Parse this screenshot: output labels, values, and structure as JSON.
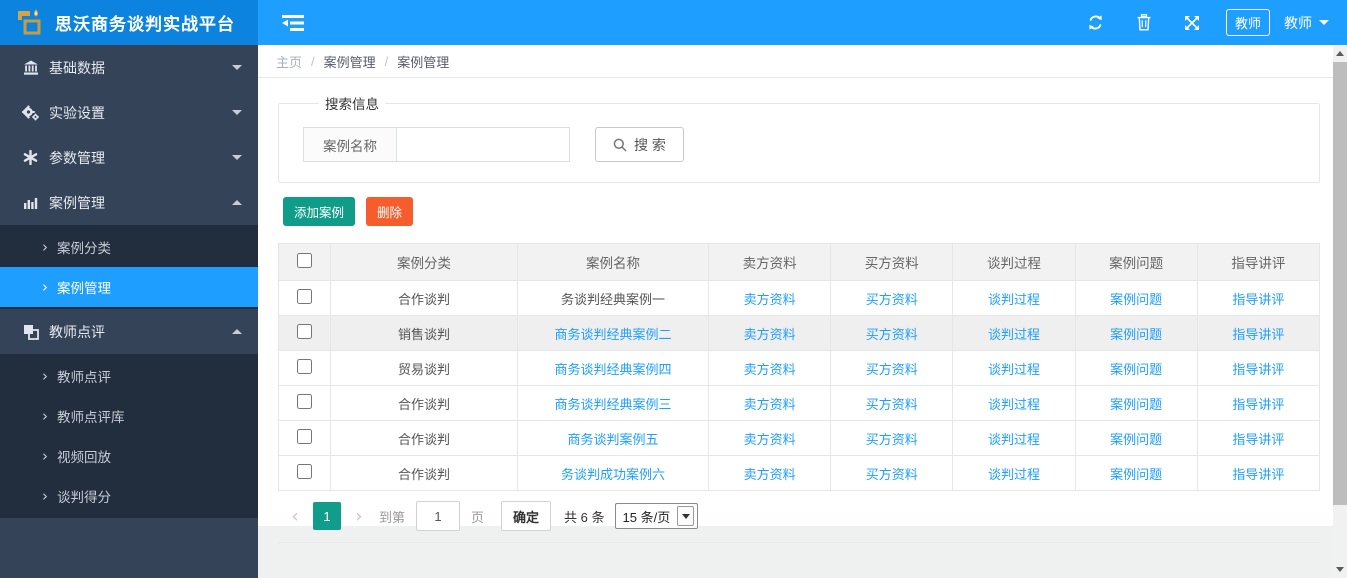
{
  "colors": {
    "header_left_bg": "#0C83DE",
    "header_right_bg": "#1E9FFF",
    "sidebar_bg": "#344358",
    "submenu_bg": "#222D3D",
    "accent_blue": "#1E9FFF",
    "teal_green": "#0F9D8A",
    "orange_red": "#F55D2C",
    "link_blue": "#1E9FFF"
  },
  "header": {
    "title": "思沃商务谈判实战平台",
    "role_badge": "教师",
    "user_name": "教师",
    "icons": [
      "menu-toggle-icon",
      "refresh-icon",
      "trash-icon",
      "expand-icon"
    ]
  },
  "sidebar": {
    "groups": [
      {
        "label": "基础数据",
        "icon": "bank-icon",
        "expanded": false
      },
      {
        "label": "实验设置",
        "icon": "gears-icon",
        "expanded": false
      },
      {
        "label": "参数管理",
        "icon": "asterisk-icon",
        "expanded": false
      },
      {
        "label": "案例管理",
        "icon": "bar-chart-icon",
        "expanded": true,
        "children": [
          {
            "label": "案例分类",
            "active": false
          },
          {
            "label": "案例管理",
            "active": true
          }
        ]
      },
      {
        "label": "教师点评",
        "icon": "clone-icon",
        "expanded": true,
        "children": [
          {
            "label": "教师点评",
            "active": false
          },
          {
            "label": "教师点评库",
            "active": false
          },
          {
            "label": "视频回放",
            "active": false
          },
          {
            "label": "谈判得分",
            "active": false
          }
        ]
      }
    ]
  },
  "breadcrumb": {
    "items": [
      "主页",
      "案例管理",
      "案例管理"
    ],
    "separator": "/"
  },
  "search": {
    "legend": "搜索信息",
    "field_label": "案例名称",
    "input_value": "",
    "button_label": "搜 索"
  },
  "toolbar": {
    "add_label": "添加案例",
    "delete_label": "删除"
  },
  "table": {
    "headers": [
      "案例分类",
      "案例名称",
      "卖方资料",
      "买方资料",
      "谈判过程",
      "案例问题",
      "指导讲评"
    ],
    "rows": [
      {
        "category": "合作谈判",
        "name": "务谈判经典案例一",
        "name_is_link": false,
        "seller": "卖方资料",
        "buyer": "买方资料",
        "process": "谈判过程",
        "question": "案例问题",
        "review": "指导讲评"
      },
      {
        "category": "销售谈判",
        "name": "商务谈判经典案例二",
        "name_is_link": true,
        "seller": "卖方资料",
        "buyer": "买方资料",
        "process": "谈判过程",
        "question": "案例问题",
        "review": "指导讲评"
      },
      {
        "category": "贸易谈判",
        "name": "商务谈判经典案例四",
        "name_is_link": true,
        "seller": "卖方资料",
        "buyer": "买方资料",
        "process": "谈判过程",
        "question": "案例问题",
        "review": "指导讲评"
      },
      {
        "category": "合作谈判",
        "name": "商务谈判经典案例三",
        "name_is_link": true,
        "seller": "卖方资料",
        "buyer": "买方资料",
        "process": "谈判过程",
        "question": "案例问题",
        "review": "指导讲评"
      },
      {
        "category": "合作谈判",
        "name": "商务谈判案例五",
        "name_is_link": true,
        "seller": "卖方资料",
        "buyer": "买方资料",
        "process": "谈判过程",
        "question": "案例问题",
        "review": "指导讲评"
      },
      {
        "category": "合作谈判",
        "name": "务谈判成功案例六",
        "name_is_link": true,
        "seller": "卖方资料",
        "buyer": "买方资料",
        "process": "谈判过程",
        "question": "案例问题",
        "review": "指导讲评"
      }
    ]
  },
  "pagination": {
    "prev_label": "‹",
    "current_page": "1",
    "next_label": "›",
    "goto_prefix": "到第",
    "goto_value": "1",
    "goto_suffix": "页",
    "confirm_label": "确定",
    "total_label": "共 6 条",
    "page_size_label": "15 条/页"
  }
}
